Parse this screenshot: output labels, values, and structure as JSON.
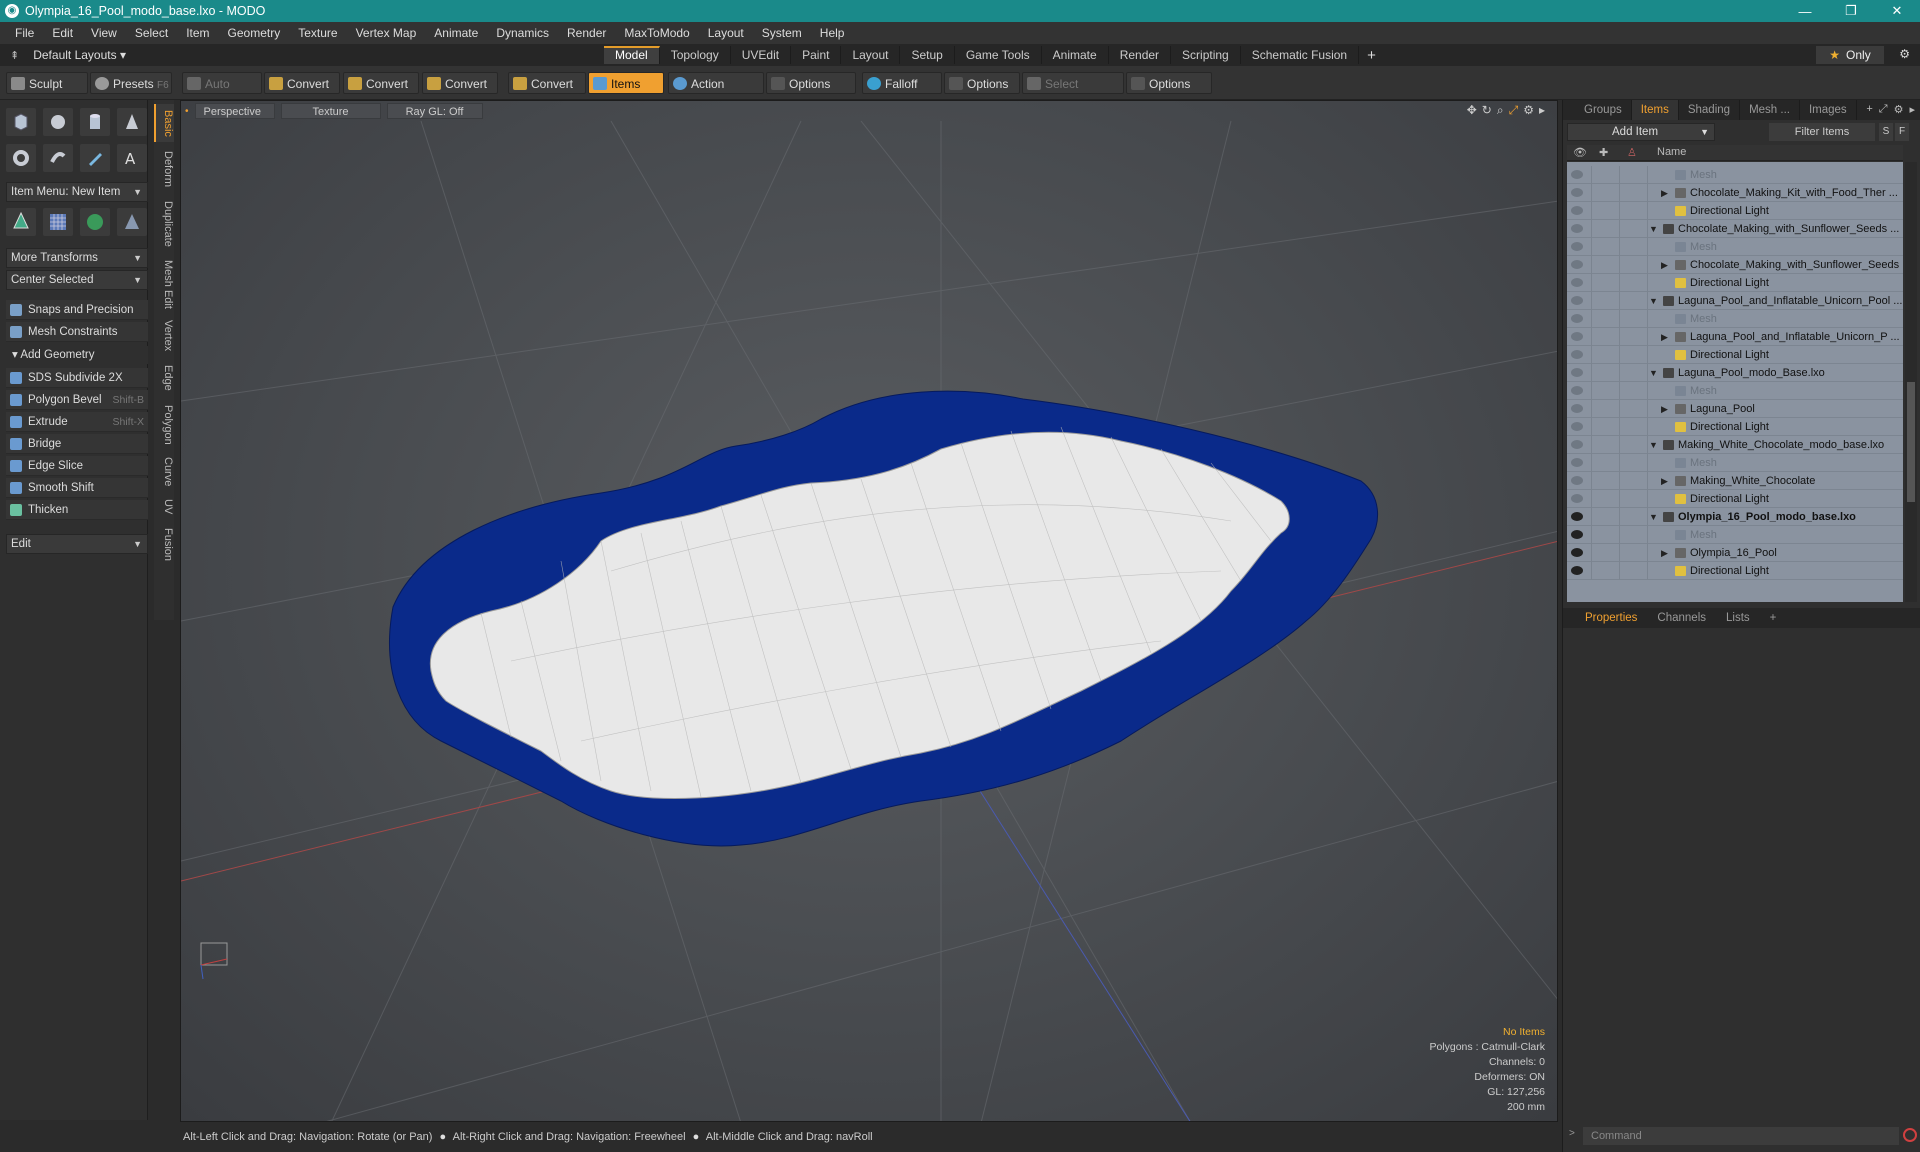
{
  "window": {
    "title": "Olympia_16_Pool_modo_base.lxo - MODO",
    "minimize": "—",
    "maximize": "❐",
    "close": "✕"
  },
  "menu": [
    "File",
    "Edit",
    "View",
    "Select",
    "Item",
    "Geometry",
    "Texture",
    "Vertex Map",
    "Animate",
    "Dynamics",
    "Render",
    "MaxToModo",
    "Layout",
    "System",
    "Help"
  ],
  "layout_bar": {
    "layouts_label": "Default Layouts ▾",
    "tabs": [
      "Model",
      "Topology",
      "UVEdit",
      "Paint",
      "Layout",
      "Setup",
      "Game Tools",
      "Animate",
      "Render",
      "Scripting",
      "Schematic Fusion"
    ],
    "active_tab": "Model",
    "only_label": "Only"
  },
  "toolbar": {
    "sculpt": "Sculpt",
    "presets": "Presets",
    "presets_key": "F6",
    "auto_select": "Auto Select",
    "convert1": "Convert",
    "convert2": "Convert",
    "convert3": "Convert",
    "convert4": "Convert",
    "items": "Items",
    "action_center": "Action Center",
    "options1": "Options",
    "falloff": "Falloff",
    "options2": "Options",
    "select_through": "Select Through",
    "options3": "Options"
  },
  "left_panel": {
    "item_menu": "Item Menu: New Item",
    "more_transforms": "More Transforms",
    "center_selected": "Center Selected",
    "snaps": "Snaps and Precision",
    "mesh_constraints": "Mesh Constraints",
    "add_geometry": "Add Geometry",
    "tools": [
      {
        "label": "SDS Subdivide 2X",
        "hotkey": ""
      },
      {
        "label": "Polygon Bevel",
        "hotkey": "Shift-B"
      },
      {
        "label": "Extrude",
        "hotkey": "Shift-X"
      },
      {
        "label": "Bridge",
        "hotkey": ""
      },
      {
        "label": "Edge Slice",
        "hotkey": ""
      },
      {
        "label": "Smooth Shift",
        "hotkey": ""
      },
      {
        "label": "Thicken",
        "hotkey": ""
      }
    ],
    "edit_dropdown": "Edit",
    "vertical_tabs": [
      "Basic",
      "Deform",
      "Duplicate",
      "Mesh Edit",
      "Vertex",
      "Edge",
      "Polygon",
      "Curve",
      "UV",
      "Fusion"
    ]
  },
  "viewport": {
    "view_mode": "Perspective",
    "shading": "Texture",
    "raygl": "Ray GL: Off",
    "stats": {
      "no_items": "No Items",
      "polygons": "Polygons : Catmull-Clark",
      "channels": "Channels: 0",
      "deformers": "Deformers: ON",
      "gl": "GL: 127,256",
      "scale": "200 mm"
    },
    "colors": {
      "pool_outer": "#0a2a8a",
      "pool_inner": "#e8e8e8"
    }
  },
  "status_bar": {
    "hint1": "Alt-Left Click and Drag: Navigation: Rotate (or Pan)",
    "hint2": "Alt-Right Click and Drag: Navigation: Freewheel",
    "hint3": "Alt-Middle Click and Drag: navRoll"
  },
  "right_panel": {
    "tabs": [
      "Groups",
      "Items",
      "Shading",
      "Mesh ...",
      "Images"
    ],
    "active_tab": "Items",
    "add_item": "Add Item",
    "filter_items": "Filter Items",
    "s_btn": "S",
    "f_btn": "F",
    "name_header": "Name",
    "items": [
      {
        "label": "Mesh",
        "indent": 2,
        "kind": "mesh",
        "dim": true,
        "eye": false
      },
      {
        "label": "Chocolate_Making_Kit_with_Food_Ther ...",
        "indent": 2,
        "kind": "group",
        "arrow": true,
        "eye": false
      },
      {
        "label": "Directional Light",
        "indent": 2,
        "kind": "light",
        "eye": false
      },
      {
        "label": "Chocolate_Making_with_Sunflower_Seeds ...",
        "indent": 1,
        "kind": "scene",
        "expanded": true,
        "eye": false
      },
      {
        "label": "Mesh",
        "indent": 2,
        "kind": "mesh",
        "dim": true,
        "eye": false
      },
      {
        "label": "Chocolate_Making_with_Sunflower_Seeds",
        "indent": 2,
        "kind": "group",
        "arrow": true,
        "eye": false
      },
      {
        "label": "Directional Light",
        "indent": 2,
        "kind": "light",
        "eye": false
      },
      {
        "label": "Laguna_Pool_and_Inflatable_Unicorn_Pool ...",
        "indent": 1,
        "kind": "scene",
        "expanded": true,
        "eye": false
      },
      {
        "label": "Mesh",
        "indent": 2,
        "kind": "mesh",
        "dim": true,
        "eye": false
      },
      {
        "label": "Laguna_Pool_and_Inflatable_Unicorn_P ...",
        "indent": 2,
        "kind": "group",
        "arrow": true,
        "eye": false
      },
      {
        "label": "Directional Light",
        "indent": 2,
        "kind": "light",
        "eye": false
      },
      {
        "label": "Laguna_Pool_modo_Base.lxo",
        "indent": 1,
        "kind": "scene",
        "expanded": true,
        "eye": false
      },
      {
        "label": "Mesh",
        "indent": 2,
        "kind": "mesh",
        "dim": true,
        "eye": false
      },
      {
        "label": "Laguna_Pool",
        "indent": 2,
        "kind": "group",
        "arrow": true,
        "eye": false
      },
      {
        "label": "Directional Light",
        "indent": 2,
        "kind": "light",
        "eye": false
      },
      {
        "label": "Making_White_Chocolate_modo_base.lxo",
        "indent": 1,
        "kind": "scene",
        "expanded": true,
        "eye": false
      },
      {
        "label": "Mesh",
        "indent": 2,
        "kind": "mesh",
        "dim": true,
        "eye": false
      },
      {
        "label": "Making_White_Chocolate",
        "indent": 2,
        "kind": "group",
        "arrow": true,
        "eye": false
      },
      {
        "label": "Directional Light",
        "indent": 2,
        "kind": "light",
        "eye": false
      },
      {
        "label": "Olympia_16_Pool_modo_base.lxo",
        "indent": 1,
        "kind": "scene",
        "expanded": true,
        "bold": true,
        "eye": true
      },
      {
        "label": "Mesh",
        "indent": 2,
        "kind": "mesh",
        "dim": true,
        "eye": true
      },
      {
        "label": "Olympia_16_Pool",
        "indent": 2,
        "kind": "group",
        "arrow": true,
        "eye": true
      },
      {
        "label": "Directional Light",
        "indent": 2,
        "kind": "light",
        "eye": true
      }
    ],
    "bottom_tabs": [
      "Properties",
      "Channels",
      "Lists"
    ],
    "bottom_active": "Properties",
    "command_placeholder": "Command"
  }
}
